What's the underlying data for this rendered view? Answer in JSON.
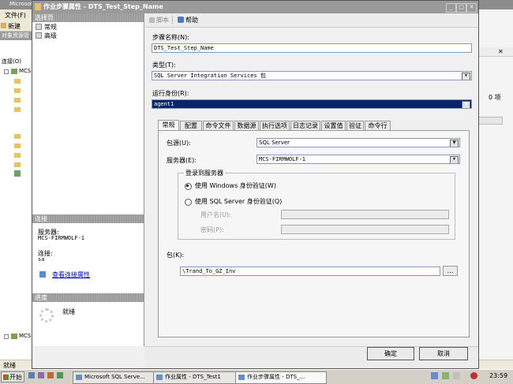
{
  "background": {
    "title": "Microsoft SQL Server Management Studio",
    "menu_file": "文件(F)",
    "toolbar_new": "新建",
    "oe_title": "对象资源管",
    "oe_connect": "连接(O)",
    "oe_root": "MCS",
    "oe_root2": "MCS",
    "right_count": "0 项",
    "status": "就绪"
  },
  "dialog": {
    "title": "作业步骤属性 - DTS_Test_Step_Name",
    "select_page_header": "选择页",
    "pages": [
      "常规",
      "高级"
    ],
    "connection_header": "连接",
    "server_label": "服务器:",
    "server_value": "MCS-FIRMWOLF-1",
    "connection_label": "连接:",
    "connection_value": "sa",
    "view_conn_link": "查看连接属性",
    "progress_header": "进度",
    "progress_status": "就绪",
    "toolbar_script": "脚本",
    "toolbar_help": "帮助",
    "step_name_label": "步骤名称(N):",
    "step_name_value": "DTS_Test_Step_Name",
    "type_label": "类型(T):",
    "type_value": "SQL Server Integration Services 包",
    "run_as_label": "运行身份(R):",
    "run_as_value": "agent1",
    "tabs": [
      "常规",
      "配置",
      "命令文件",
      "数据源",
      "执行选项",
      "日志记录",
      "设置值",
      "验证",
      "命令行"
    ],
    "pkg_source_label": "包源(U):",
    "pkg_source_value": "SQL Server",
    "server_field_label": "服务器(E):",
    "server_field_value": "MCS-FIRMWOLF-1",
    "login_group": "登录到服务器",
    "win_auth": "使用 Windows 身份验证(W)",
    "sql_auth": "使用 SQL Server 身份验证(Q)",
    "user_label": "用户名(U):",
    "password_label": "密码(P):",
    "package_label": "包(K):",
    "package_value": "\\Trand_To_GZ_Inv",
    "browse": "...",
    "ok": "确定",
    "cancel": "取消"
  },
  "taskbar": {
    "start": "开始",
    "tasks": [
      "Microsoft SQL Serve...",
      "作业属性 - DTS_Test1",
      "作业步骤属性 - DTS_..."
    ],
    "clock": "23:59"
  },
  "colors": {
    "selected_field": "#0a246a",
    "link": "#0000cc",
    "section_header": "#9b9b9b"
  }
}
